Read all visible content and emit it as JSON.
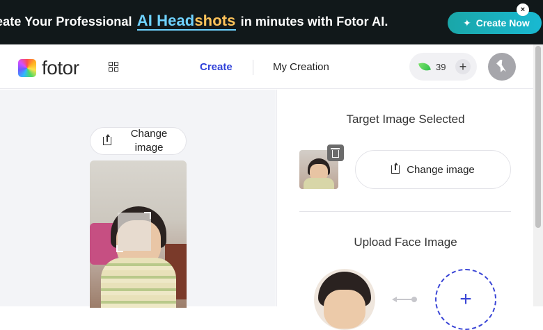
{
  "banner": {
    "text_before": "eate Your Professional",
    "highlight_a": "AI Head",
    "highlight_b": "shots",
    "text_after": "in minutes with Fotor AI.",
    "cta_label": "Create Now",
    "close_label": "×"
  },
  "header": {
    "logo_text": "fotor",
    "nav_create": "Create",
    "nav_my_creation": "My Creation",
    "credits_count": "39",
    "credits_add_label": "+"
  },
  "left_panel": {
    "change_image_label": "Change image"
  },
  "right_panel": {
    "target_title": "Target Image Selected",
    "change_image_label": "Change image",
    "upload_face_title": "Upload Face Image",
    "add_face_label": "+"
  },
  "colors": {
    "accent": "#3042d9",
    "banner_bg": "#11181a",
    "cta_gradient_start": "#1aa6a8",
    "panel_bg": "#f3f4f7"
  },
  "icons": [
    "magic-wand-icon",
    "close-icon",
    "apps-grid-icon",
    "leaf-credit-icon",
    "plus-icon",
    "bird-avatar-icon",
    "upload-icon",
    "trash-icon",
    "swap-arrow-icon"
  ]
}
